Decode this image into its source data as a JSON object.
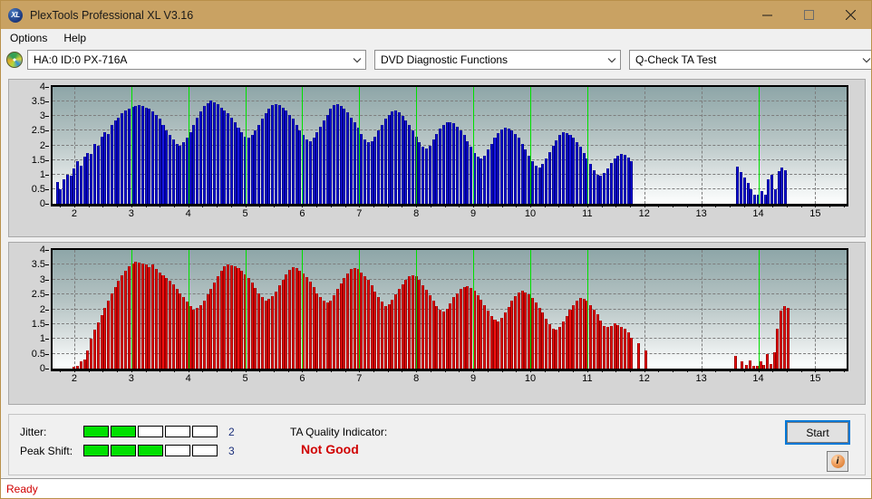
{
  "window": {
    "title": "PlexTools Professional XL V3.16",
    "app_icon": "xl-logo-icon",
    "minimize_label": "Minimize",
    "maximize_label": "Maximize",
    "close_label": "Close",
    "titlebar_color": "#c9a263"
  },
  "menu": {
    "items": [
      {
        "label": "Options"
      },
      {
        "label": "Help"
      }
    ]
  },
  "toolbar": {
    "drive_icon": "disc-icon",
    "drive_selector": {
      "value": "HA:0 ID:0  PX-716A"
    },
    "function_selector": {
      "value": "DVD Diagnostic Functions"
    },
    "test_selector": {
      "value": "Q-Check TA Test"
    }
  },
  "results": {
    "jitter_label": "Jitter:",
    "jitter_value": "2",
    "jitter_segments_total": 5,
    "jitter_segments_filled": 2,
    "peak_shift_label": "Peak Shift:",
    "peak_shift_value": "3",
    "peak_shift_segments_total": 5,
    "peak_shift_segments_filled": 3,
    "ta_quality_label": "TA Quality Indicator:",
    "ta_quality_value": "Not Good",
    "ta_quality_color": "#d00000",
    "segment_on_color": "#00e000",
    "start_label": "Start",
    "info_label": "i"
  },
  "statusbar": {
    "text": "Ready"
  },
  "chart_data": [
    {
      "type": "bar",
      "id": "jitter-chart",
      "title": "",
      "xlabel": "",
      "ylabel": "",
      "series_color": "#1515e0",
      "ylim": [
        0,
        4
      ],
      "yticks": [
        0,
        0.5,
        1,
        1.5,
        2,
        2.5,
        3,
        3.5,
        4
      ],
      "ytick_labels": [
        "0",
        "0.5",
        "1",
        "1.5",
        "2",
        "2.5",
        "3",
        "3.5",
        "4"
      ],
      "xlim": [
        1.62,
        15.55
      ],
      "xticks": [
        2,
        3,
        4,
        5,
        6,
        7,
        8,
        9,
        10,
        11,
        12,
        13,
        14,
        15
      ],
      "xtick_labels": [
        "2",
        "3",
        "4",
        "5",
        "6",
        "7",
        "8",
        "9",
        "10",
        "11",
        "12",
        "13",
        "14",
        "15"
      ],
      "grid": true,
      "marker_lines_color": "#00e000",
      "marker_lines_x": [
        3,
        4,
        5,
        6,
        7,
        8,
        9,
        10,
        11,
        14
      ],
      "x": [
        1.7,
        1.76,
        1.82,
        1.88,
        1.94,
        2.0,
        2.06,
        2.12,
        2.18,
        2.24,
        2.3,
        2.36,
        2.42,
        2.48,
        2.54,
        2.6,
        2.66,
        2.72,
        2.78,
        2.84,
        2.9,
        2.96,
        3.02,
        3.08,
        3.14,
        3.2,
        3.26,
        3.32,
        3.38,
        3.44,
        3.5,
        3.56,
        3.62,
        3.68,
        3.74,
        3.8,
        3.86,
        3.92,
        3.98,
        4.04,
        4.1,
        4.16,
        4.22,
        4.28,
        4.34,
        4.4,
        4.46,
        4.52,
        4.58,
        4.64,
        4.7,
        4.76,
        4.82,
        4.88,
        4.94,
        5.0,
        5.06,
        5.12,
        5.18,
        5.24,
        5.3,
        5.36,
        5.42,
        5.48,
        5.54,
        5.6,
        5.66,
        5.72,
        5.78,
        5.84,
        5.9,
        5.96,
        6.02,
        6.08,
        6.14,
        6.2,
        6.26,
        6.32,
        6.38,
        6.44,
        6.5,
        6.56,
        6.62,
        6.68,
        6.74,
        6.8,
        6.86,
        6.92,
        6.98,
        7.04,
        7.1,
        7.16,
        7.22,
        7.28,
        7.34,
        7.4,
        7.46,
        7.52,
        7.58,
        7.64,
        7.7,
        7.76,
        7.82,
        7.88,
        7.94,
        8.0,
        8.06,
        8.12,
        8.18,
        8.24,
        8.3,
        8.36,
        8.42,
        8.48,
        8.54,
        8.6,
        8.66,
        8.72,
        8.78,
        8.84,
        8.9,
        8.96,
        9.02,
        9.08,
        9.14,
        9.2,
        9.26,
        9.32,
        9.38,
        9.44,
        9.5,
        9.56,
        9.62,
        9.68,
        9.74,
        9.8,
        9.86,
        9.92,
        9.98,
        10.04,
        10.1,
        10.16,
        10.22,
        10.28,
        10.34,
        10.4,
        10.46,
        10.52,
        10.58,
        10.64,
        10.7,
        10.76,
        10.82,
        10.88,
        10.94,
        11.0,
        11.06,
        11.12,
        11.18,
        11.24,
        11.3,
        11.36,
        11.42,
        11.48,
        11.54,
        11.6,
        11.66,
        11.72,
        11.78,
        13.64,
        13.7,
        13.76,
        13.82,
        13.88,
        13.94,
        14.0,
        14.06,
        14.12,
        14.18,
        14.24,
        14.3,
        14.36,
        14.42,
        14.48
      ],
      "values": [
        0.75,
        0.5,
        0.85,
        1.0,
        0.95,
        1.2,
        1.45,
        1.3,
        1.6,
        1.75,
        1.7,
        2.05,
        2.0,
        2.3,
        2.45,
        2.4,
        2.7,
        2.85,
        2.95,
        3.1,
        3.2,
        3.25,
        3.32,
        3.35,
        3.38,
        3.35,
        3.3,
        3.25,
        3.15,
        3.05,
        2.9,
        2.7,
        2.5,
        2.35,
        2.2,
        2.05,
        2.0,
        2.1,
        2.25,
        2.45,
        2.7,
        2.95,
        3.15,
        3.35,
        3.45,
        3.52,
        3.48,
        3.4,
        3.3,
        3.2,
        3.1,
        2.95,
        2.8,
        2.6,
        2.45,
        2.3,
        2.25,
        2.35,
        2.5,
        2.7,
        2.9,
        3.1,
        3.25,
        3.38,
        3.42,
        3.38,
        3.3,
        3.2,
        3.05,
        2.9,
        2.7,
        2.5,
        2.35,
        2.2,
        2.15,
        2.25,
        2.45,
        2.65,
        2.85,
        3.05,
        3.25,
        3.38,
        3.4,
        3.35,
        3.25,
        3.12,
        2.95,
        2.8,
        2.6,
        2.4,
        2.2,
        2.1,
        2.15,
        2.3,
        2.5,
        2.7,
        2.9,
        3.05,
        3.15,
        3.18,
        3.12,
        3.0,
        2.85,
        2.7,
        2.5,
        2.3,
        2.1,
        1.95,
        1.9,
        2.0,
        2.2,
        2.4,
        2.58,
        2.7,
        2.78,
        2.8,
        2.75,
        2.65,
        2.5,
        2.35,
        2.15,
        1.95,
        1.75,
        1.6,
        1.55,
        1.65,
        1.85,
        2.05,
        2.25,
        2.42,
        2.55,
        2.6,
        2.58,
        2.5,
        2.38,
        2.25,
        2.05,
        1.85,
        1.65,
        1.45,
        1.3,
        1.25,
        1.35,
        1.55,
        1.78,
        2.0,
        2.18,
        2.35,
        2.45,
        2.42,
        2.35,
        2.25,
        2.1,
        1.95,
        1.75,
        1.55,
        1.35,
        1.15,
        1.0,
        0.95,
        1.05,
        1.22,
        1.4,
        1.55,
        1.65,
        1.7,
        1.68,
        1.58,
        1.45,
        1.28,
        1.1,
        0.9,
        0.7,
        0.5,
        0.32,
        0.3,
        0.45,
        0.3,
        0.85,
        1.0,
        0.5,
        1.12,
        1.25,
        1.15,
        1.3,
        1.2,
        1.08,
        0.95,
        0.6,
        0.35
      ],
      "bar_count": 185
    },
    {
      "type": "bar",
      "id": "peak-shift-chart",
      "title": "",
      "xlabel": "",
      "ylabel": "",
      "series_color": "#f01010",
      "ylim": [
        0,
        4
      ],
      "yticks": [
        0,
        0.5,
        1,
        1.5,
        2,
        2.5,
        3,
        3.5,
        4
      ],
      "ytick_labels": [
        "0",
        "0.5",
        "1",
        "1.5",
        "2",
        "2.5",
        "3",
        "3.5",
        "4"
      ],
      "xlim": [
        1.62,
        15.55
      ],
      "xticks": [
        2,
        3,
        4,
        5,
        6,
        7,
        8,
        9,
        10,
        11,
        12,
        13,
        14,
        15
      ],
      "xtick_labels": [
        "2",
        "3",
        "4",
        "5",
        "6",
        "7",
        "8",
        "9",
        "10",
        "11",
        "12",
        "13",
        "14",
        "15"
      ],
      "grid": true,
      "marker_lines_color": "#00e000",
      "marker_lines_x": [
        3,
        4,
        5,
        6,
        7,
        8,
        9,
        10,
        11,
        14
      ],
      "x": [
        2.0,
        2.06,
        2.12,
        2.18,
        2.24,
        2.3,
        2.36,
        2.42,
        2.48,
        2.54,
        2.6,
        2.66,
        2.72,
        2.78,
        2.84,
        2.9,
        2.96,
        3.02,
        3.08,
        3.14,
        3.2,
        3.26,
        3.32,
        3.38,
        3.44,
        3.5,
        3.56,
        3.62,
        3.68,
        3.74,
        3.8,
        3.86,
        3.92,
        3.98,
        4.04,
        4.1,
        4.16,
        4.22,
        4.28,
        4.34,
        4.4,
        4.46,
        4.52,
        4.58,
        4.64,
        4.7,
        4.76,
        4.82,
        4.88,
        4.94,
        5.0,
        5.06,
        5.12,
        5.18,
        5.24,
        5.3,
        5.36,
        5.42,
        5.48,
        5.54,
        5.6,
        5.66,
        5.72,
        5.78,
        5.84,
        5.9,
        5.96,
        6.02,
        6.08,
        6.14,
        6.2,
        6.26,
        6.32,
        6.38,
        6.44,
        6.5,
        6.56,
        6.62,
        6.68,
        6.74,
        6.8,
        6.86,
        6.92,
        6.98,
        7.04,
        7.1,
        7.16,
        7.22,
        7.28,
        7.34,
        7.4,
        7.46,
        7.52,
        7.58,
        7.64,
        7.7,
        7.76,
        7.82,
        7.88,
        7.94,
        8.0,
        8.06,
        8.12,
        8.18,
        8.24,
        8.3,
        8.36,
        8.42,
        8.48,
        8.54,
        8.6,
        8.66,
        8.72,
        8.78,
        8.84,
        8.9,
        8.96,
        9.02,
        9.08,
        9.14,
        9.2,
        9.26,
        9.32,
        9.38,
        9.44,
        9.5,
        9.56,
        9.62,
        9.68,
        9.74,
        9.8,
        9.86,
        9.92,
        9.98,
        10.04,
        10.1,
        10.16,
        10.22,
        10.28,
        10.34,
        10.4,
        10.46,
        10.52,
        10.58,
        10.64,
        10.7,
        10.76,
        10.82,
        10.88,
        10.94,
        11.0,
        11.06,
        11.12,
        11.18,
        11.24,
        11.3,
        11.36,
        11.42,
        11.48,
        11.54,
        11.6,
        11.66,
        11.72,
        11.78,
        11.9,
        12.02,
        13.6,
        13.72,
        13.8,
        13.86,
        13.92,
        13.98,
        14.04,
        14.1,
        14.16,
        14.22,
        14.28,
        14.34,
        14.4,
        14.46,
        14.52
      ],
      "values": [
        0.05,
        0.1,
        0.25,
        0.3,
        0.6,
        1.0,
        1.3,
        1.55,
        1.8,
        2.05,
        2.3,
        2.55,
        2.75,
        2.95,
        3.15,
        3.3,
        3.45,
        3.55,
        3.6,
        3.58,
        3.55,
        3.5,
        3.42,
        3.5,
        3.35,
        3.25,
        3.15,
        3.05,
        2.95,
        2.85,
        2.7,
        2.55,
        2.4,
        2.25,
        2.1,
        2.0,
        2.05,
        2.15,
        2.3,
        2.5,
        2.7,
        2.9,
        3.1,
        3.3,
        3.45,
        3.52,
        3.48,
        3.45,
        3.38,
        3.3,
        3.18,
        3.05,
        2.9,
        2.72,
        2.55,
        2.4,
        2.3,
        2.35,
        2.45,
        2.6,
        2.8,
        3.0,
        3.18,
        3.32,
        3.42,
        3.38,
        3.3,
        3.2,
        3.08,
        2.92,
        2.75,
        2.55,
        2.4,
        2.28,
        2.22,
        2.3,
        2.48,
        2.68,
        2.88,
        3.05,
        3.22,
        3.35,
        3.4,
        3.35,
        3.25,
        3.12,
        2.98,
        2.8,
        2.6,
        2.42,
        2.25,
        2.12,
        2.18,
        2.32,
        2.5,
        2.68,
        2.85,
        3.0,
        3.1,
        3.15,
        3.1,
        2.98,
        2.82,
        2.65,
        2.48,
        2.3,
        2.12,
        1.98,
        1.92,
        2.02,
        2.2,
        2.4,
        2.55,
        2.68,
        2.75,
        2.78,
        2.72,
        2.62,
        2.48,
        2.32,
        2.15,
        1.95,
        1.78,
        1.65,
        1.6,
        1.7,
        1.88,
        2.08,
        2.28,
        2.45,
        2.58,
        2.62,
        2.58,
        2.5,
        2.38,
        2.22,
        2.05,
        1.88,
        1.68,
        1.5,
        1.35,
        1.3,
        1.4,
        1.58,
        1.78,
        1.98,
        2.15,
        2.3,
        2.38,
        2.35,
        2.28,
        2.15,
        2.0,
        1.82,
        1.62,
        1.45,
        1.4,
        1.45,
        1.52,
        1.48,
        1.42,
        1.35,
        1.22,
        1.05,
        0.85,
        0.62,
        0.42,
        0.25,
        0.12,
        0.28,
        0.1,
        0.1,
        0.25,
        0.12,
        0.48,
        0.15,
        0.55,
        1.35,
        1.95,
        2.1,
        2.05,
        1.9,
        1.7,
        1.45,
        1.1,
        0.72
      ],
      "bar_count": 178
    }
  ]
}
